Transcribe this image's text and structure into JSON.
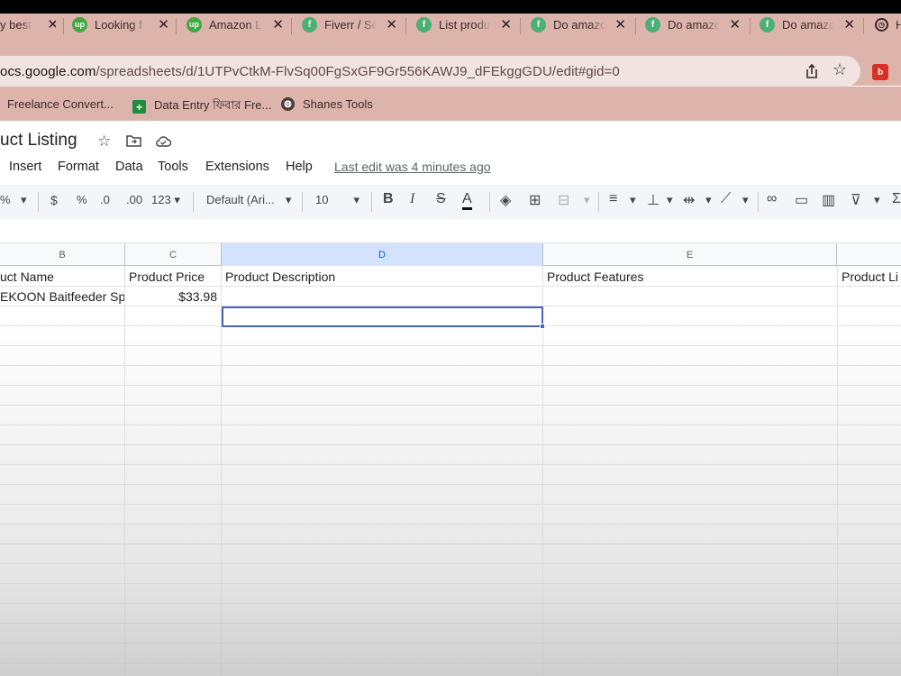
{
  "browser": {
    "tabs": [
      {
        "label": "y best",
        "icon": "none"
      },
      {
        "label": "Looking f",
        "icon": "upwork-icon"
      },
      {
        "label": "Amazon L",
        "icon": "upwork-icon"
      },
      {
        "label": "Fiverr / Se",
        "icon": "fiverr-icon"
      },
      {
        "label": "List produ",
        "icon": "fiverr-icon"
      },
      {
        "label": "Do amazo",
        "icon": "fiverr-icon"
      },
      {
        "label": "Do amazo",
        "icon": "fiverr-icon"
      },
      {
        "label": "Do amazo",
        "icon": "fiverr-icon"
      },
      {
        "label": "H",
        "icon": "history-icon"
      }
    ],
    "url_host": "docs.google.com",
    "url_path": "/spreadsheets/d/1UTPvCtkM-FlvSq00FgSxGF9Gr556KAWJ9_dFEkggGDU/edit#gid=0",
    "url_visible": "ocs.google.com",
    "bookmarks": [
      {
        "label": "Freelance Convert...",
        "icon": "none"
      },
      {
        "label": "Data Entry ফিবার Fre...",
        "icon": "sheets-icon"
      },
      {
        "label": "Shanes Tools",
        "icon": "globe-icon"
      }
    ]
  },
  "doc": {
    "title": "uct Listing",
    "menus": [
      "Insert",
      "Format",
      "Data",
      "Tools",
      "Extensions",
      "Help"
    ],
    "last_edit": "Last edit was 4 minutes ago"
  },
  "toolbar": {
    "percent_partial": "%",
    "currency": "$",
    "percent": "%",
    "decrease_decimal": ".0",
    "increase_decimal": ".00",
    "number_format": "123",
    "font": "Default (Ari...",
    "font_size": "10"
  },
  "grid": {
    "columns": [
      "B",
      "C",
      "D",
      "E"
    ],
    "header_row": [
      "uct Name",
      "Product Price",
      "Product Description",
      "Product Features",
      "Product Li"
    ],
    "row2": [
      "EKOON Baitfeeder Sp",
      "$33.98",
      "",
      "",
      ""
    ]
  }
}
